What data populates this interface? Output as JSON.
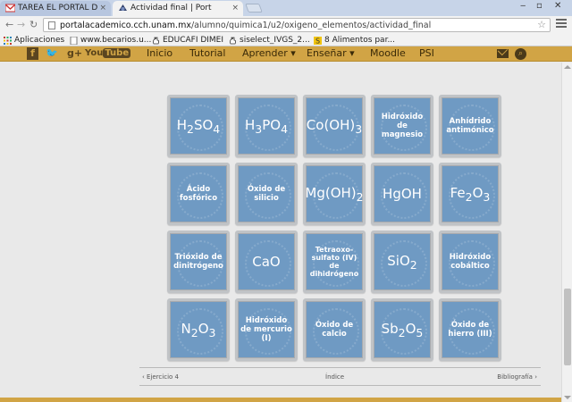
{
  "browser": {
    "tabs": [
      {
        "title": "TAREA EL PORTAL D",
        "icon": "gmail-icon"
      },
      {
        "title": "Actividad final | Port",
        "icon": "site-favicon"
      }
    ],
    "close_glyph": "×",
    "url": {
      "host": "portalacademico.cch.unam.mx",
      "path": "/alumno/quimica1/u2/oxigeno_elementos/actividad_final"
    },
    "bookmarks": [
      {
        "label": "Aplicaciones",
        "icon": "apps-grid-icon"
      },
      {
        "label": "www.becarios.u...",
        "icon": "page-icon"
      },
      {
        "label": "EDUCAFI DIMEI",
        "icon": "hand-icon"
      },
      {
        "label": "siselect_IVGS_2...",
        "icon": "hand-icon"
      },
      {
        "label": "8 Alimentos par...",
        "icon": "bookmark-s-icon"
      }
    ]
  },
  "site_nav": {
    "social": {
      "facebook": "f",
      "twitter": "🐦",
      "gplus": "g+",
      "youtube_a": "You",
      "youtube_b": "Tube"
    },
    "links": [
      "Inicio",
      "Tutorial",
      "Aprender ▾",
      "Enseñar ▾",
      "Moodle",
      "PSI"
    ]
  },
  "cards": [
    {
      "kind": "formula",
      "html": "H<sub>2</sub>SO<sub>4</sub>"
    },
    {
      "kind": "formula",
      "html": "H<sub>3</sub>PO<sub>4</sub>"
    },
    {
      "kind": "formula",
      "html": "Co(OH)<sub>3</sub>"
    },
    {
      "kind": "name",
      "text": "Hidróxido de magnesio"
    },
    {
      "kind": "name",
      "text": "Anhídrido antimónico"
    },
    {
      "kind": "name",
      "text": "Ácido fosfórico"
    },
    {
      "kind": "name",
      "text": "Óxido de silicio"
    },
    {
      "kind": "formula",
      "html": "Mg(OH)<sub>2</sub>"
    },
    {
      "kind": "formula",
      "html": "HgOH"
    },
    {
      "kind": "formula",
      "html": "Fe<sub>2</sub>O<sub>3</sub>"
    },
    {
      "kind": "name",
      "text": "Trióxido de dinitrógeno"
    },
    {
      "kind": "formula",
      "html": "CaO"
    },
    {
      "kind": "small",
      "text": "Tetraoxo-sulfato (IV) de dihidrógeno"
    },
    {
      "kind": "formula",
      "html": "SiO<sub>2</sub>"
    },
    {
      "kind": "name",
      "text": "Hidróxido cobáltico"
    },
    {
      "kind": "formula",
      "html": "N<sub>2</sub>O<sub>3</sub>"
    },
    {
      "kind": "name",
      "text": "Hidróxido de mercurio (I)"
    },
    {
      "kind": "name",
      "text": "Óxido de calcio"
    },
    {
      "kind": "formula",
      "html": "Sb<sub>2</sub>O<sub>5</sub>"
    },
    {
      "kind": "name",
      "text": "Óxido de hierro (III)"
    }
  ],
  "pager": {
    "prev": "‹ Ejercicio 4",
    "index": "Índice",
    "next": "Bibliografía ›"
  }
}
